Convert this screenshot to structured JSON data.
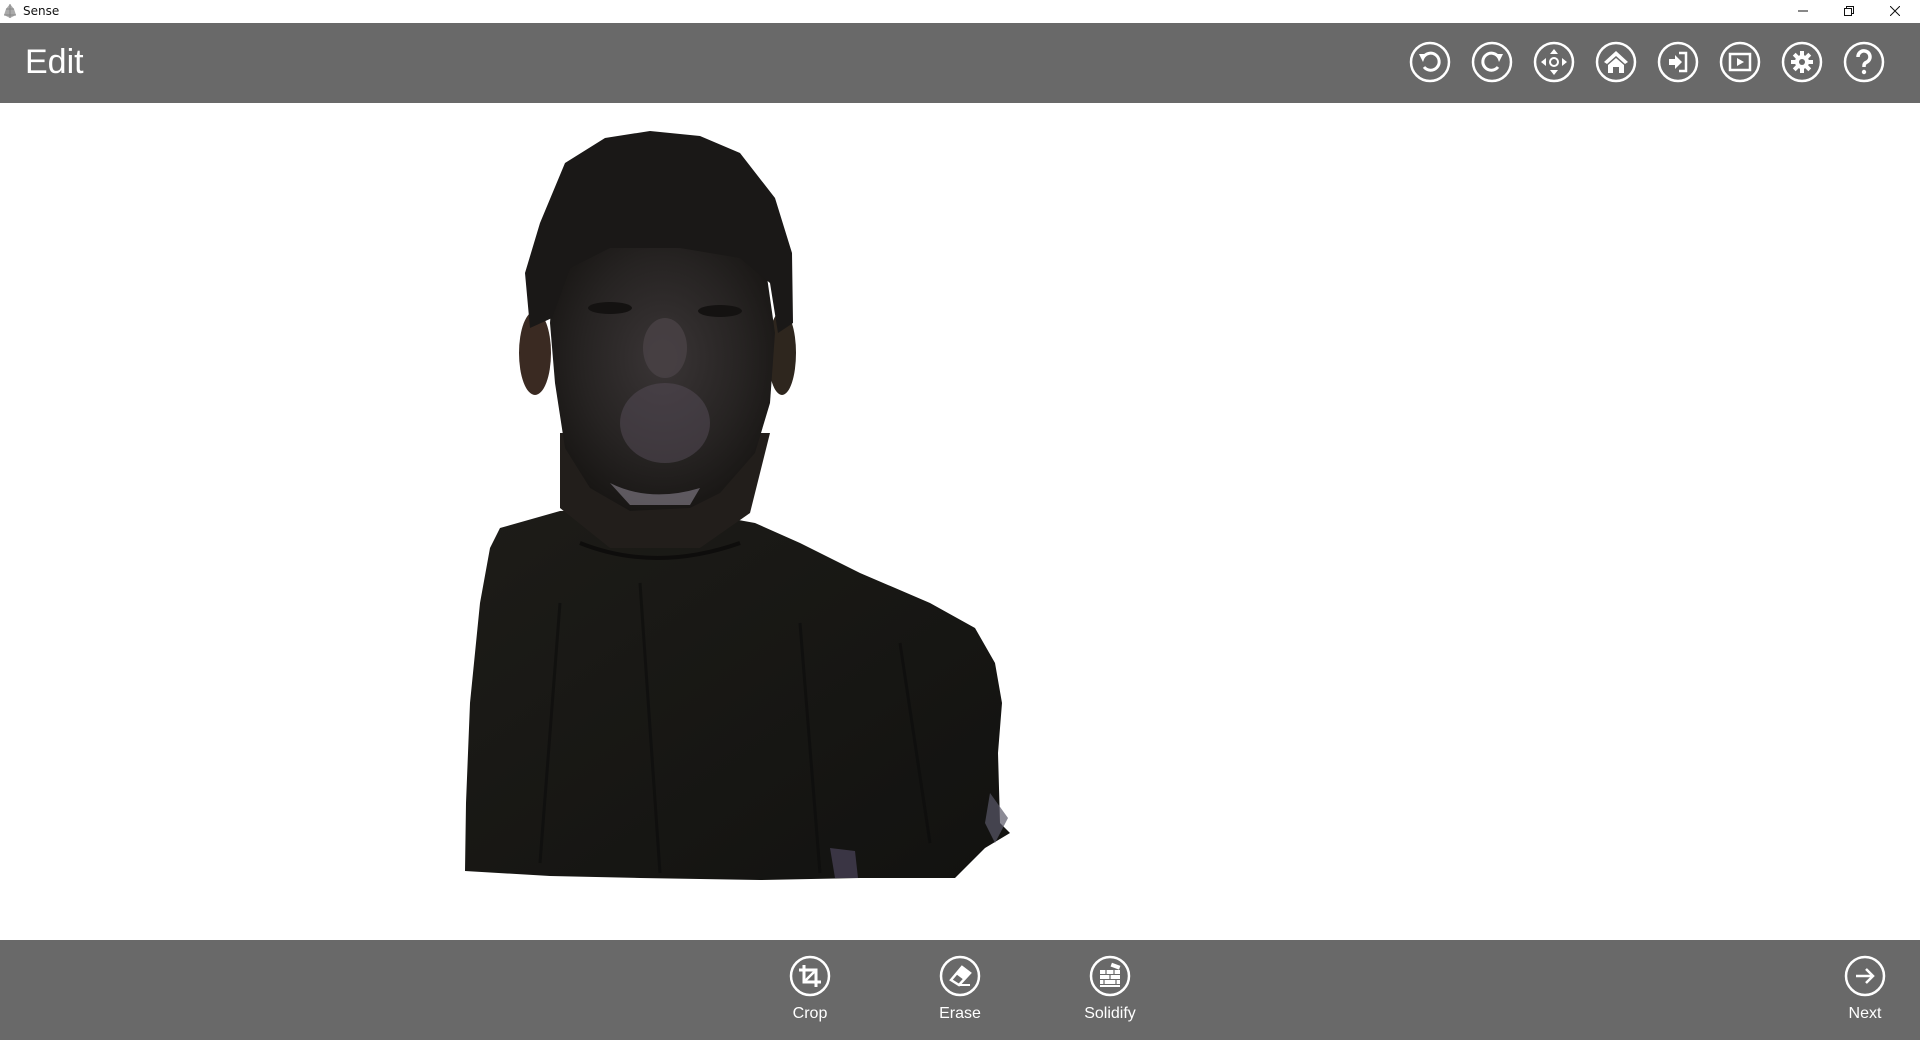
{
  "window": {
    "app_title": "Sense",
    "app_icon": "sense-logo-icon",
    "controls": [
      {
        "name": "minimize",
        "icon": "minimize-icon"
      },
      {
        "name": "restore",
        "icon": "restore-icon"
      },
      {
        "name": "close",
        "icon": "close-icon"
      }
    ]
  },
  "header": {
    "title": "Edit",
    "toolbar": [
      {
        "name": "undo",
        "icon": "undo-icon"
      },
      {
        "name": "redo",
        "icon": "redo-icon"
      },
      {
        "name": "move",
        "icon": "move-icon"
      },
      {
        "name": "home",
        "icon": "home-icon"
      },
      {
        "name": "import",
        "icon": "import-icon"
      },
      {
        "name": "play",
        "icon": "play-icon"
      },
      {
        "name": "settings",
        "icon": "gear-icon"
      },
      {
        "name": "help",
        "icon": "help-icon"
      }
    ]
  },
  "viewport": {
    "content": "3D scanned bust model of a person wearing a dark shirt",
    "background": "#ffffff"
  },
  "footer": {
    "tools": [
      {
        "label": "Crop",
        "icon": "crop-icon"
      },
      {
        "label": "Erase",
        "icon": "eraser-icon"
      },
      {
        "label": "Solidify",
        "icon": "solidify-icon"
      }
    ],
    "next_label": "Next",
    "next_icon": "arrow-right-icon"
  },
  "colors": {
    "bar": "#696969",
    "icon": "#ffffff",
    "text": "#ffffff"
  }
}
